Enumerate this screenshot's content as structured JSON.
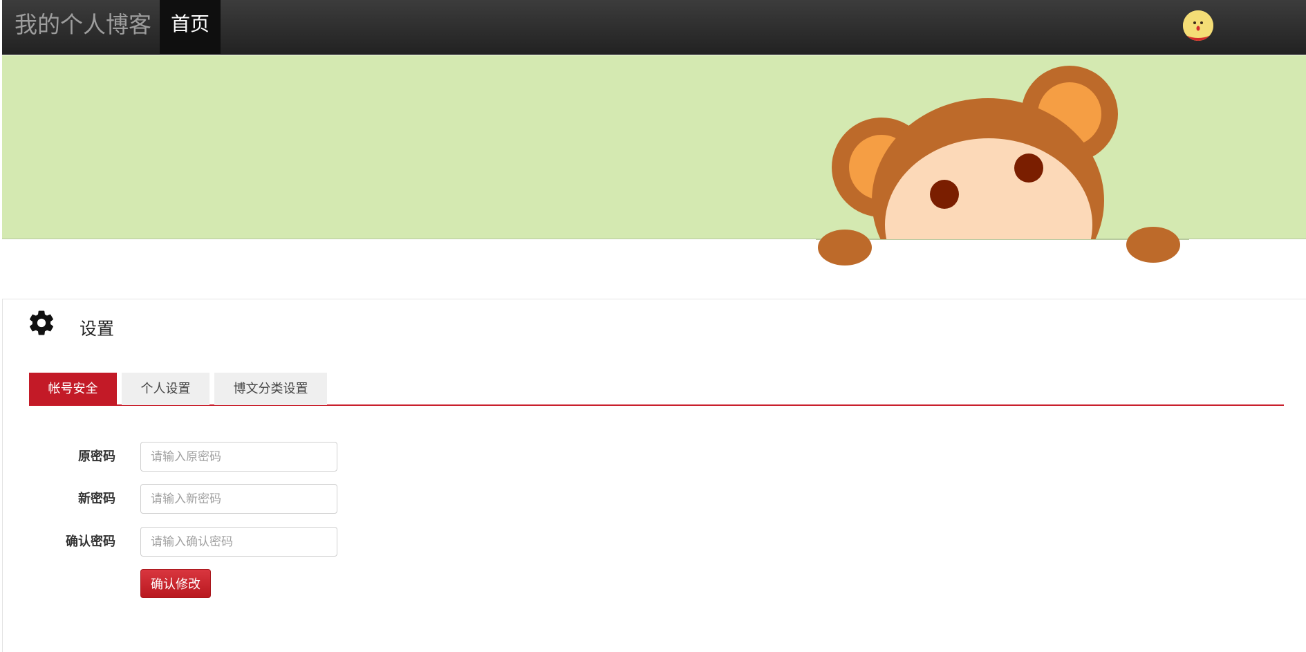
{
  "navbar": {
    "brand": "我的个人博客",
    "home_label": "首页",
    "avatar_icon": "avatar-face-icon"
  },
  "banner": {
    "background_color": "#d4e9b1",
    "illustration": "monkey"
  },
  "settings": {
    "title": "设置",
    "icon": "gear-icon",
    "tabs": [
      {
        "label": "帐号安全",
        "active": true
      },
      {
        "label": "个人设置",
        "active": false
      },
      {
        "label": "博文分类设置",
        "active": false
      }
    ],
    "form": {
      "old_password": {
        "label": "原密码",
        "placeholder": "请输入原密码",
        "value": ""
      },
      "new_password": {
        "label": "新密码",
        "placeholder": "请输入新密码",
        "value": ""
      },
      "confirm_password": {
        "label": "确认密码",
        "placeholder": "请输入确认密码",
        "value": ""
      },
      "submit_label": "确认修改"
    }
  },
  "colors": {
    "accent": "#c31a27",
    "navbar": "#222222"
  }
}
